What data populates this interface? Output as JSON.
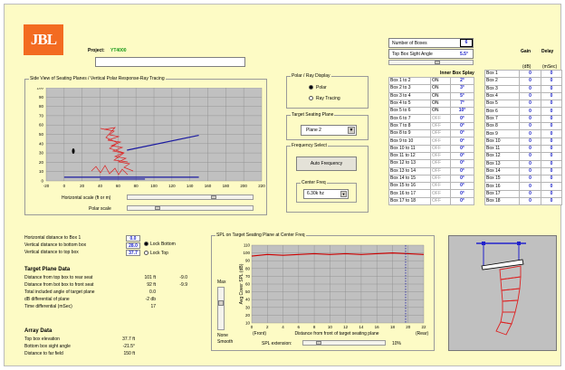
{
  "header": {
    "logo_text": "JBL",
    "project_label": "Project:",
    "project_value": "YT4000"
  },
  "side_view": {
    "title": "Side View of Seating Planes / Vertical Polar Response-Ray Tracing",
    "y_ticks": [
      "100",
      "90",
      "80",
      "70",
      "60",
      "50",
      "40",
      "30",
      "20",
      "10",
      "0"
    ],
    "x_ticks": [
      "-20",
      "0",
      "20",
      "40",
      "60",
      "80",
      "100",
      "120",
      "140",
      "160",
      "180",
      "200",
      "220"
    ],
    "hscale_label": "Horizontal scale (ft or m)",
    "polar_scale_label": "Polar scale"
  },
  "polar_display": {
    "title": "Polar / Ray Display",
    "options": [
      "Polar",
      "Ray Tracing"
    ],
    "selected": "Polar"
  },
  "target_plane": {
    "title": "Target Seating Plane",
    "value": "Plane 2"
  },
  "frequency": {
    "title": "Frequency Select",
    "button": "Auto Frequency",
    "center_title": "Center Freq",
    "center_value": "6.30k hz"
  },
  "boxes": {
    "count_label": "Number of Boxes",
    "count_value": "6",
    "sight_label": "Top Box Sight Angle",
    "sight_value": "5.5°",
    "gain_label": "Gain",
    "delay_label": "Delay",
    "gain_unit": "(dB)",
    "delay_unit": "(mSec)",
    "inner_label": "Inner Box Splay",
    "splay_rows": [
      {
        "name": "Box 1 to 2",
        "state": "ON",
        "deg": "2°"
      },
      {
        "name": "Box 2 to 3",
        "state": "ON",
        "deg": "3°"
      },
      {
        "name": "Box 3 to 4",
        "state": "ON",
        "deg": "5°"
      },
      {
        "name": "Box 4 to 5",
        "state": "ON",
        "deg": "7°"
      },
      {
        "name": "Box 5 to 6",
        "state": "ON",
        "deg": "10°"
      },
      {
        "name": "Box 6 to 7",
        "state": "OFF",
        "deg": "0°"
      },
      {
        "name": "Box 7 to 8",
        "state": "OFF",
        "deg": "0°"
      },
      {
        "name": "Box 8 to 9",
        "state": "OFF",
        "deg": "0°"
      },
      {
        "name": "Box 9 to 10",
        "state": "OFF",
        "deg": "0°"
      },
      {
        "name": "Box 10 to 11",
        "state": "OFF",
        "deg": "0°"
      },
      {
        "name": "Box 11 to 12",
        "state": "OFF",
        "deg": "0°"
      },
      {
        "name": "Box 12 to 13",
        "state": "OFF",
        "deg": "0°"
      },
      {
        "name": "Box 13 to 14",
        "state": "OFF",
        "deg": "0°"
      },
      {
        "name": "Box 14 to 15",
        "state": "OFF",
        "deg": "0°"
      },
      {
        "name": "Box 15 to 16",
        "state": "OFF",
        "deg": "0°"
      },
      {
        "name": "Box 16 to 17",
        "state": "OFF",
        "deg": "0°"
      },
      {
        "name": "Box 17 to 18",
        "state": "OFF",
        "deg": "0°"
      }
    ],
    "gain_rows": [
      {
        "name": "Box 1",
        "gain": "0",
        "delay": "0"
      },
      {
        "name": "Box 2",
        "gain": "0",
        "delay": "0"
      },
      {
        "name": "Box 3",
        "gain": "0",
        "delay": "0"
      },
      {
        "name": "Box 4",
        "gain": "0",
        "delay": "0"
      },
      {
        "name": "Box 5",
        "gain": "0",
        "delay": "0"
      },
      {
        "name": "Box 6",
        "gain": "0",
        "delay": "0"
      },
      {
        "name": "Box 7",
        "gain": "0",
        "delay": "0"
      },
      {
        "name": "Box 8",
        "gain": "0",
        "delay": "0"
      },
      {
        "name": "Box 9",
        "gain": "0",
        "delay": "0"
      },
      {
        "name": "Box 10",
        "gain": "0",
        "delay": "0"
      },
      {
        "name": "Box 11",
        "gain": "0",
        "delay": "0"
      },
      {
        "name": "Box 12",
        "gain": "0",
        "delay": "0"
      },
      {
        "name": "Box 13",
        "gain": "0",
        "delay": "0"
      },
      {
        "name": "Box 14",
        "gain": "0",
        "delay": "0"
      },
      {
        "name": "Box 15",
        "gain": "0",
        "delay": "0"
      },
      {
        "name": "Box 16",
        "gain": "0",
        "delay": "0"
      },
      {
        "name": "Box 17",
        "gain": "0",
        "delay": "0"
      },
      {
        "name": "Box 18",
        "gain": "0",
        "delay": "0"
      }
    ]
  },
  "distances": {
    "rows": [
      {
        "label": "Horizontal distance to Box 1",
        "value": "0.0"
      },
      {
        "label": "Vertical distance to bottom box",
        "value": "28.0"
      },
      {
        "label": "Vertical distance to top box",
        "value": "37.7"
      }
    ],
    "lock_options": [
      "Lock Bottom",
      "Lock Top"
    ],
    "lock_selected": "Lock Bottom"
  },
  "target_data": {
    "title": "Target Plane Data",
    "rows": [
      {
        "label": "Distance from top box to rear seat",
        "v1": "101 ft",
        "v2": "-9.0"
      },
      {
        "label": "Distance from bot box to front seat",
        "v1": "92 ft",
        "v2": "-9.9"
      },
      {
        "label": "Total included angle of target plane",
        "v1": "0.0",
        "v2": ""
      },
      {
        "label": "dB differential of plane",
        "v1": "-2 db",
        "v2": ""
      },
      {
        "label": "Time differential (mSec)",
        "v1": "17",
        "v2": ""
      }
    ]
  },
  "array_data": {
    "title": "Array Data",
    "rows": [
      {
        "label": "Top box elevation",
        "value": "37.7 ft"
      },
      {
        "label": "Bottom box sight angle",
        "value": "-21.5°"
      },
      {
        "label": "Distance to far field",
        "value": "150 ft"
      }
    ]
  },
  "spl": {
    "title": "SPL on Target Seating Plane at Center Freq",
    "y_ticks": [
      "110",
      "100",
      "90",
      "80",
      "70",
      "60",
      "50",
      "40",
      "30",
      "20",
      "10"
    ],
    "x_ticks": [
      "0",
      "2",
      "4",
      "6",
      "8",
      "10",
      "12",
      "14",
      "16",
      "18",
      "20",
      "22"
    ],
    "ylabel": "Avg Cover SPL (dB)",
    "xlabel": "Distance from front of target seating plane",
    "front_label": "(Front)",
    "rear_label": "(Rear)",
    "max_label": "Max",
    "none_label": "None",
    "smooth_label": "Smooth",
    "extension_label": "SPL extension:",
    "extension_value": "10%"
  },
  "chart_data": [
    {
      "type": "line",
      "title": "Side View of Seating Planes / Vertical Polar Response-Ray Tracing",
      "xlabel": "Horizontal scale (ft or m)",
      "ylabel": "",
      "xlim": [
        -20,
        220
      ],
      "ylim": [
        0,
        100
      ],
      "grid": true,
      "series": [
        {
          "x": [
            0,
            150
          ],
          "y": [
            4,
            4
          ],
          "color": "#1a1aa0"
        },
        {
          "x": [
            70,
            150
          ],
          "y": [
            33,
            49
          ],
          "color": "#1a1aa0"
        },
        {
          "x": [
            40,
            90
          ],
          "y": [
            2,
            2
          ],
          "color": "#1a1aa0"
        }
      ]
    },
    {
      "type": "line",
      "title": "SPL on Target Seating Plane at Center Freq",
      "xlabel": "Distance from front of target seating plane",
      "ylabel": "Avg Cover SPL (dB)",
      "xlim": [
        0,
        22
      ],
      "ylim": [
        10,
        110
      ],
      "grid": true,
      "series": [
        {
          "x": [
            0,
            2,
            4,
            6,
            8,
            10,
            12,
            14,
            16,
            18,
            20,
            22
          ],
          "y": [
            96,
            98,
            97,
            98,
            99,
            98,
            99,
            98,
            99,
            100,
            99,
            98
          ],
          "color": "#cc0000"
        }
      ]
    }
  ]
}
